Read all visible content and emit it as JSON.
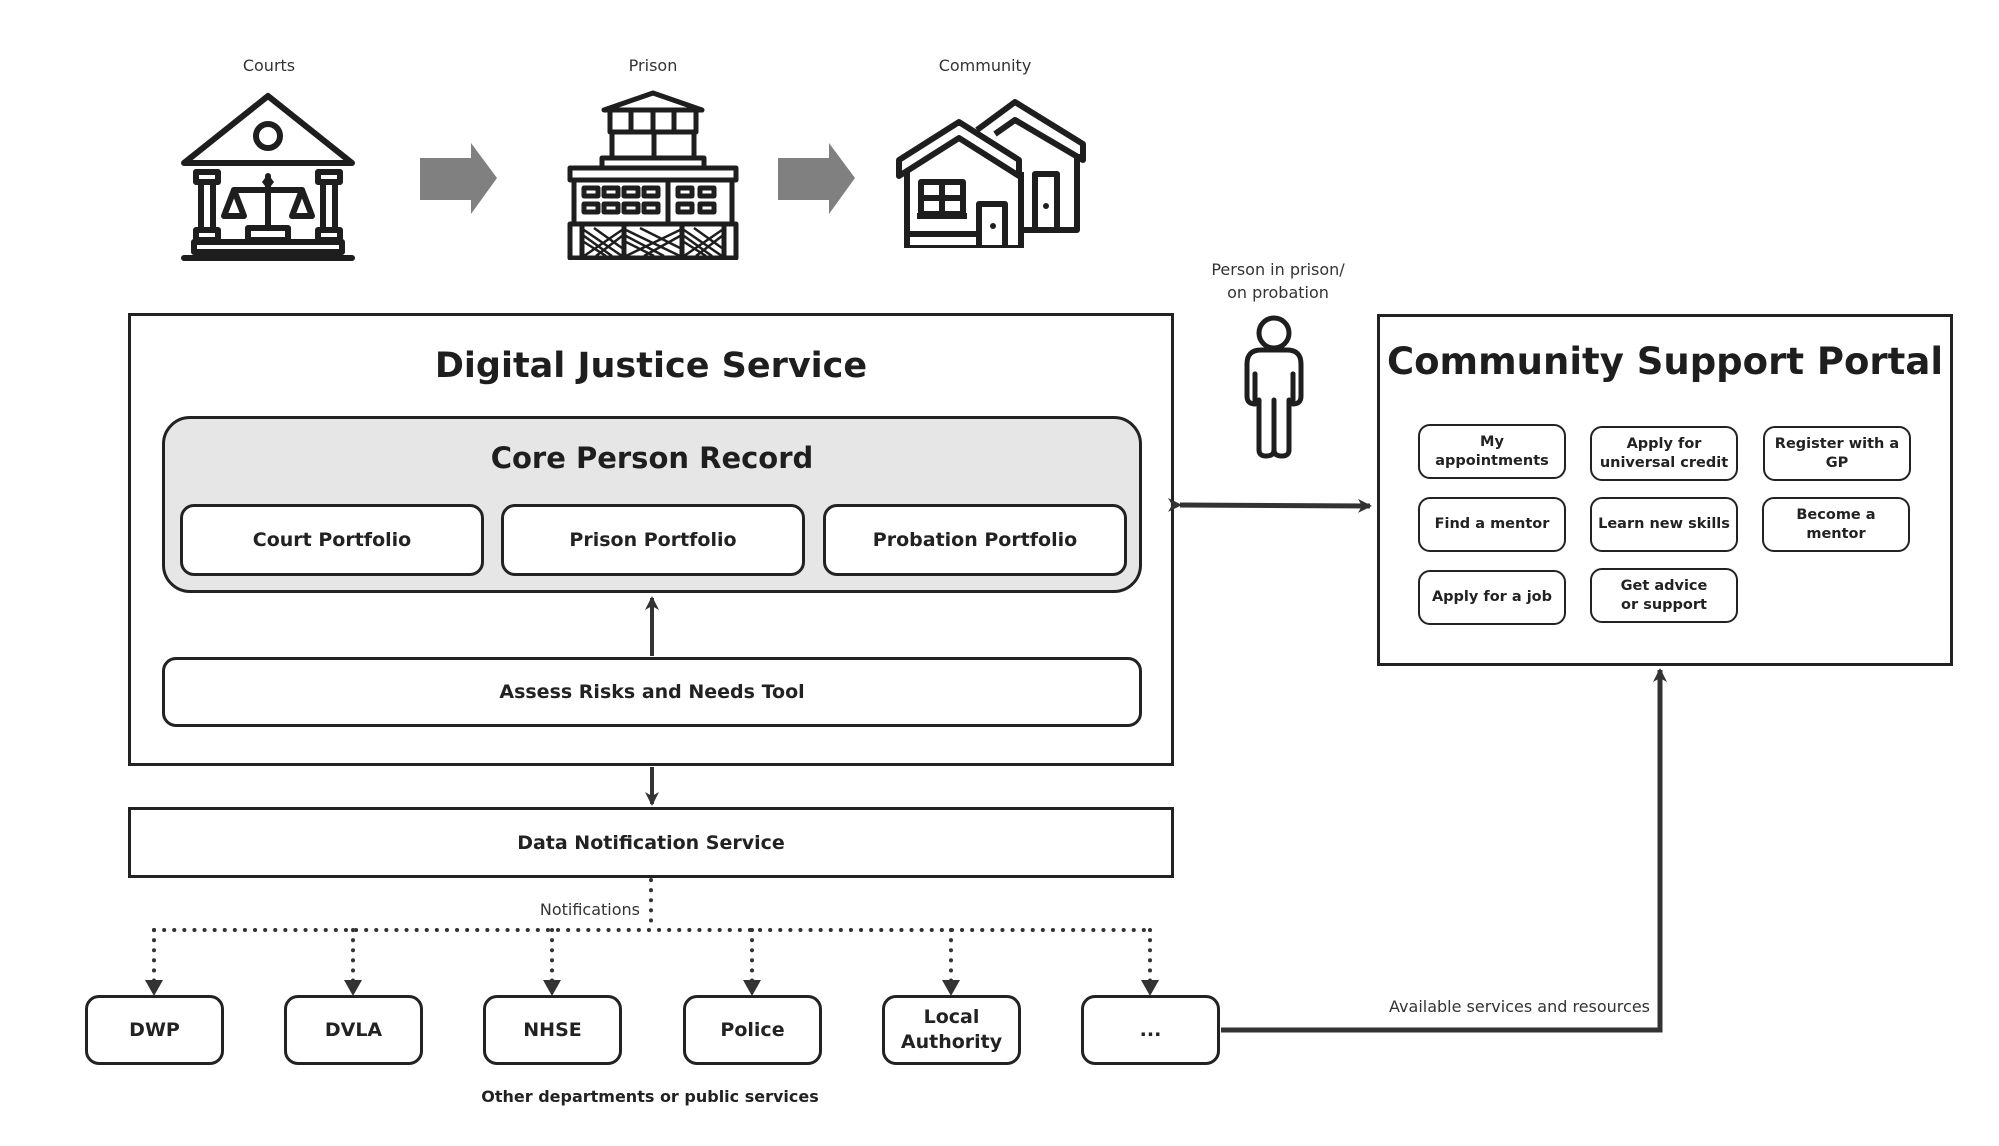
{
  "stages": [
    {
      "label": "Courts",
      "icon": "courthouse-icon"
    },
    {
      "label": "Prison",
      "icon": "prison-icon"
    },
    {
      "label": "Community",
      "icon": "houses-icon"
    }
  ],
  "stage_arrow_color": "#808080",
  "person": {
    "label_line1": "Person in prison/",
    "label_line2": "on probation",
    "icon": "person-icon"
  },
  "digital_justice_service": {
    "title": "Digital Justice Service",
    "core_person_record": {
      "title": "Core Person Record",
      "fill": "#e6e6e6",
      "portfolios": [
        "Court Portfolio",
        "Prison Portfolio",
        "Probation Portfolio"
      ]
    },
    "assess_tool": "Assess Risks and Needs Tool"
  },
  "data_notification_service": {
    "label": "Data Notification Service",
    "notifications_label": "Notifications"
  },
  "departments": {
    "items": [
      "DWP",
      "DVLA",
      "NHSE",
      "Police",
      "Local Authority",
      "..."
    ],
    "caption": "Other departments or public services"
  },
  "community_support_portal": {
    "title": "Community Support Portal",
    "items": [
      "My appointments",
      "Apply for universal credit",
      "Register with a GP",
      "Find a mentor",
      "Learn new skills",
      "Become a mentor",
      "Apply for a job",
      "Get advice or support"
    ]
  },
  "available_services_label": "Available services and resources",
  "line_color": "#333333"
}
